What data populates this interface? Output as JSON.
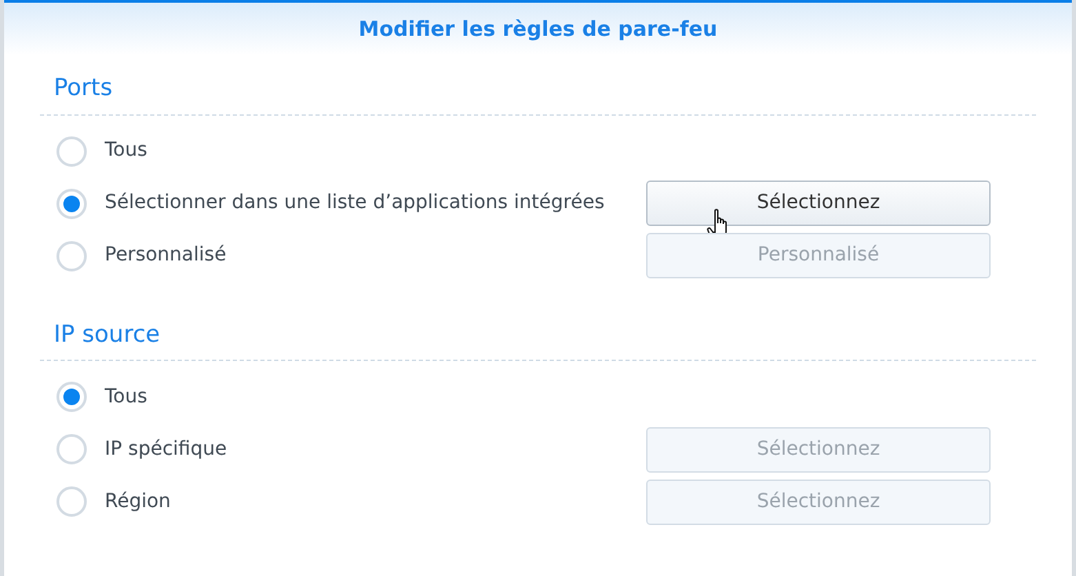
{
  "dialog": {
    "title": "Modifier les règles de pare-feu"
  },
  "sections": [
    {
      "title": "Ports",
      "options": [
        {
          "label": "Tous",
          "selected": false
        },
        {
          "label": "Sélectionner dans une liste d’applications intégrées",
          "selected": true,
          "button": {
            "label": "Sélectionnez",
            "disabled": false,
            "hovered": true
          }
        },
        {
          "label": "Personnalisé",
          "selected": false,
          "button": {
            "label": "Personnalisé",
            "disabled": true,
            "hovered": false
          }
        }
      ]
    },
    {
      "title": "IP source",
      "options": [
        {
          "label": "Tous",
          "selected": true
        },
        {
          "label": "IP spécifique",
          "selected": false,
          "button": {
            "label": "Sélectionnez",
            "disabled": true,
            "hovered": false
          }
        },
        {
          "label": "Région",
          "selected": false,
          "button": {
            "label": "Sélectionnez",
            "disabled": true,
            "hovered": false
          }
        }
      ]
    }
  ]
}
